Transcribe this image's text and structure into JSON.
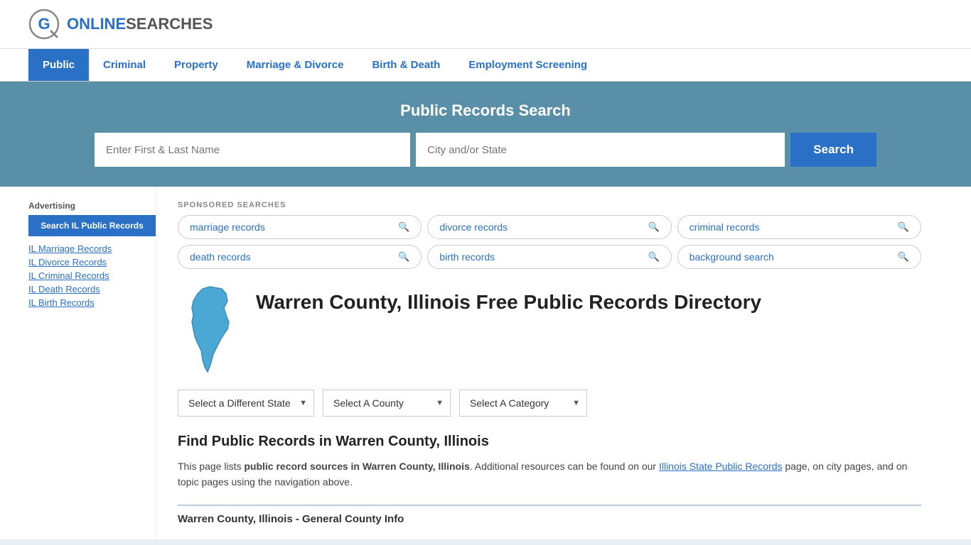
{
  "logo": {
    "text_online": "ONLINE",
    "text_searches": "SEARCHES",
    "icon_label": "OnlineSearches logo"
  },
  "nav": {
    "items": [
      {
        "label": "Public",
        "active": true
      },
      {
        "label": "Criminal",
        "active": false
      },
      {
        "label": "Property",
        "active": false
      },
      {
        "label": "Marriage & Divorce",
        "active": false
      },
      {
        "label": "Birth & Death",
        "active": false
      },
      {
        "label": "Employment Screening",
        "active": false
      }
    ]
  },
  "search_banner": {
    "title": "Public Records Search",
    "name_placeholder": "Enter First & Last Name",
    "location_placeholder": "City and/or State",
    "button_label": "Search"
  },
  "sponsored": {
    "label": "SPONSORED SEARCHES",
    "tags": [
      {
        "label": "marriage records"
      },
      {
        "label": "divorce records"
      },
      {
        "label": "criminal records"
      },
      {
        "label": "death records"
      },
      {
        "label": "birth records"
      },
      {
        "label": "background search"
      }
    ]
  },
  "county": {
    "title": "Warren County, Illinois Free Public Records Directory"
  },
  "dropdowns": {
    "state_label": "Select a Different State",
    "county_label": "Select A County",
    "category_label": "Select A Category"
  },
  "find_records": {
    "title": "Find Public Records in Warren County, Illinois",
    "description_start": "This page lists ",
    "description_bold": "public record sources in Warren County, Illinois",
    "description_mid": ". Additional resources can be found on our ",
    "description_link": "Illinois State Public Records",
    "description_end": " page, on city pages, and on topic pages using the navigation above."
  },
  "general_info": {
    "header": "Warren County, Illinois - General County Info"
  },
  "sidebar": {
    "advertising_label": "Advertising",
    "ad_button": "Search IL Public Records",
    "links": [
      {
        "label": "IL Marriage Records"
      },
      {
        "label": "IL Divorce Records"
      },
      {
        "label": "IL Criminal Records"
      },
      {
        "label": "IL Death Records"
      },
      {
        "label": "IL Birth Records"
      }
    ]
  },
  "colors": {
    "blue": "#2970c6",
    "banner_bg": "#5a8fa8",
    "illinois_shape": "#4ba8d4"
  }
}
